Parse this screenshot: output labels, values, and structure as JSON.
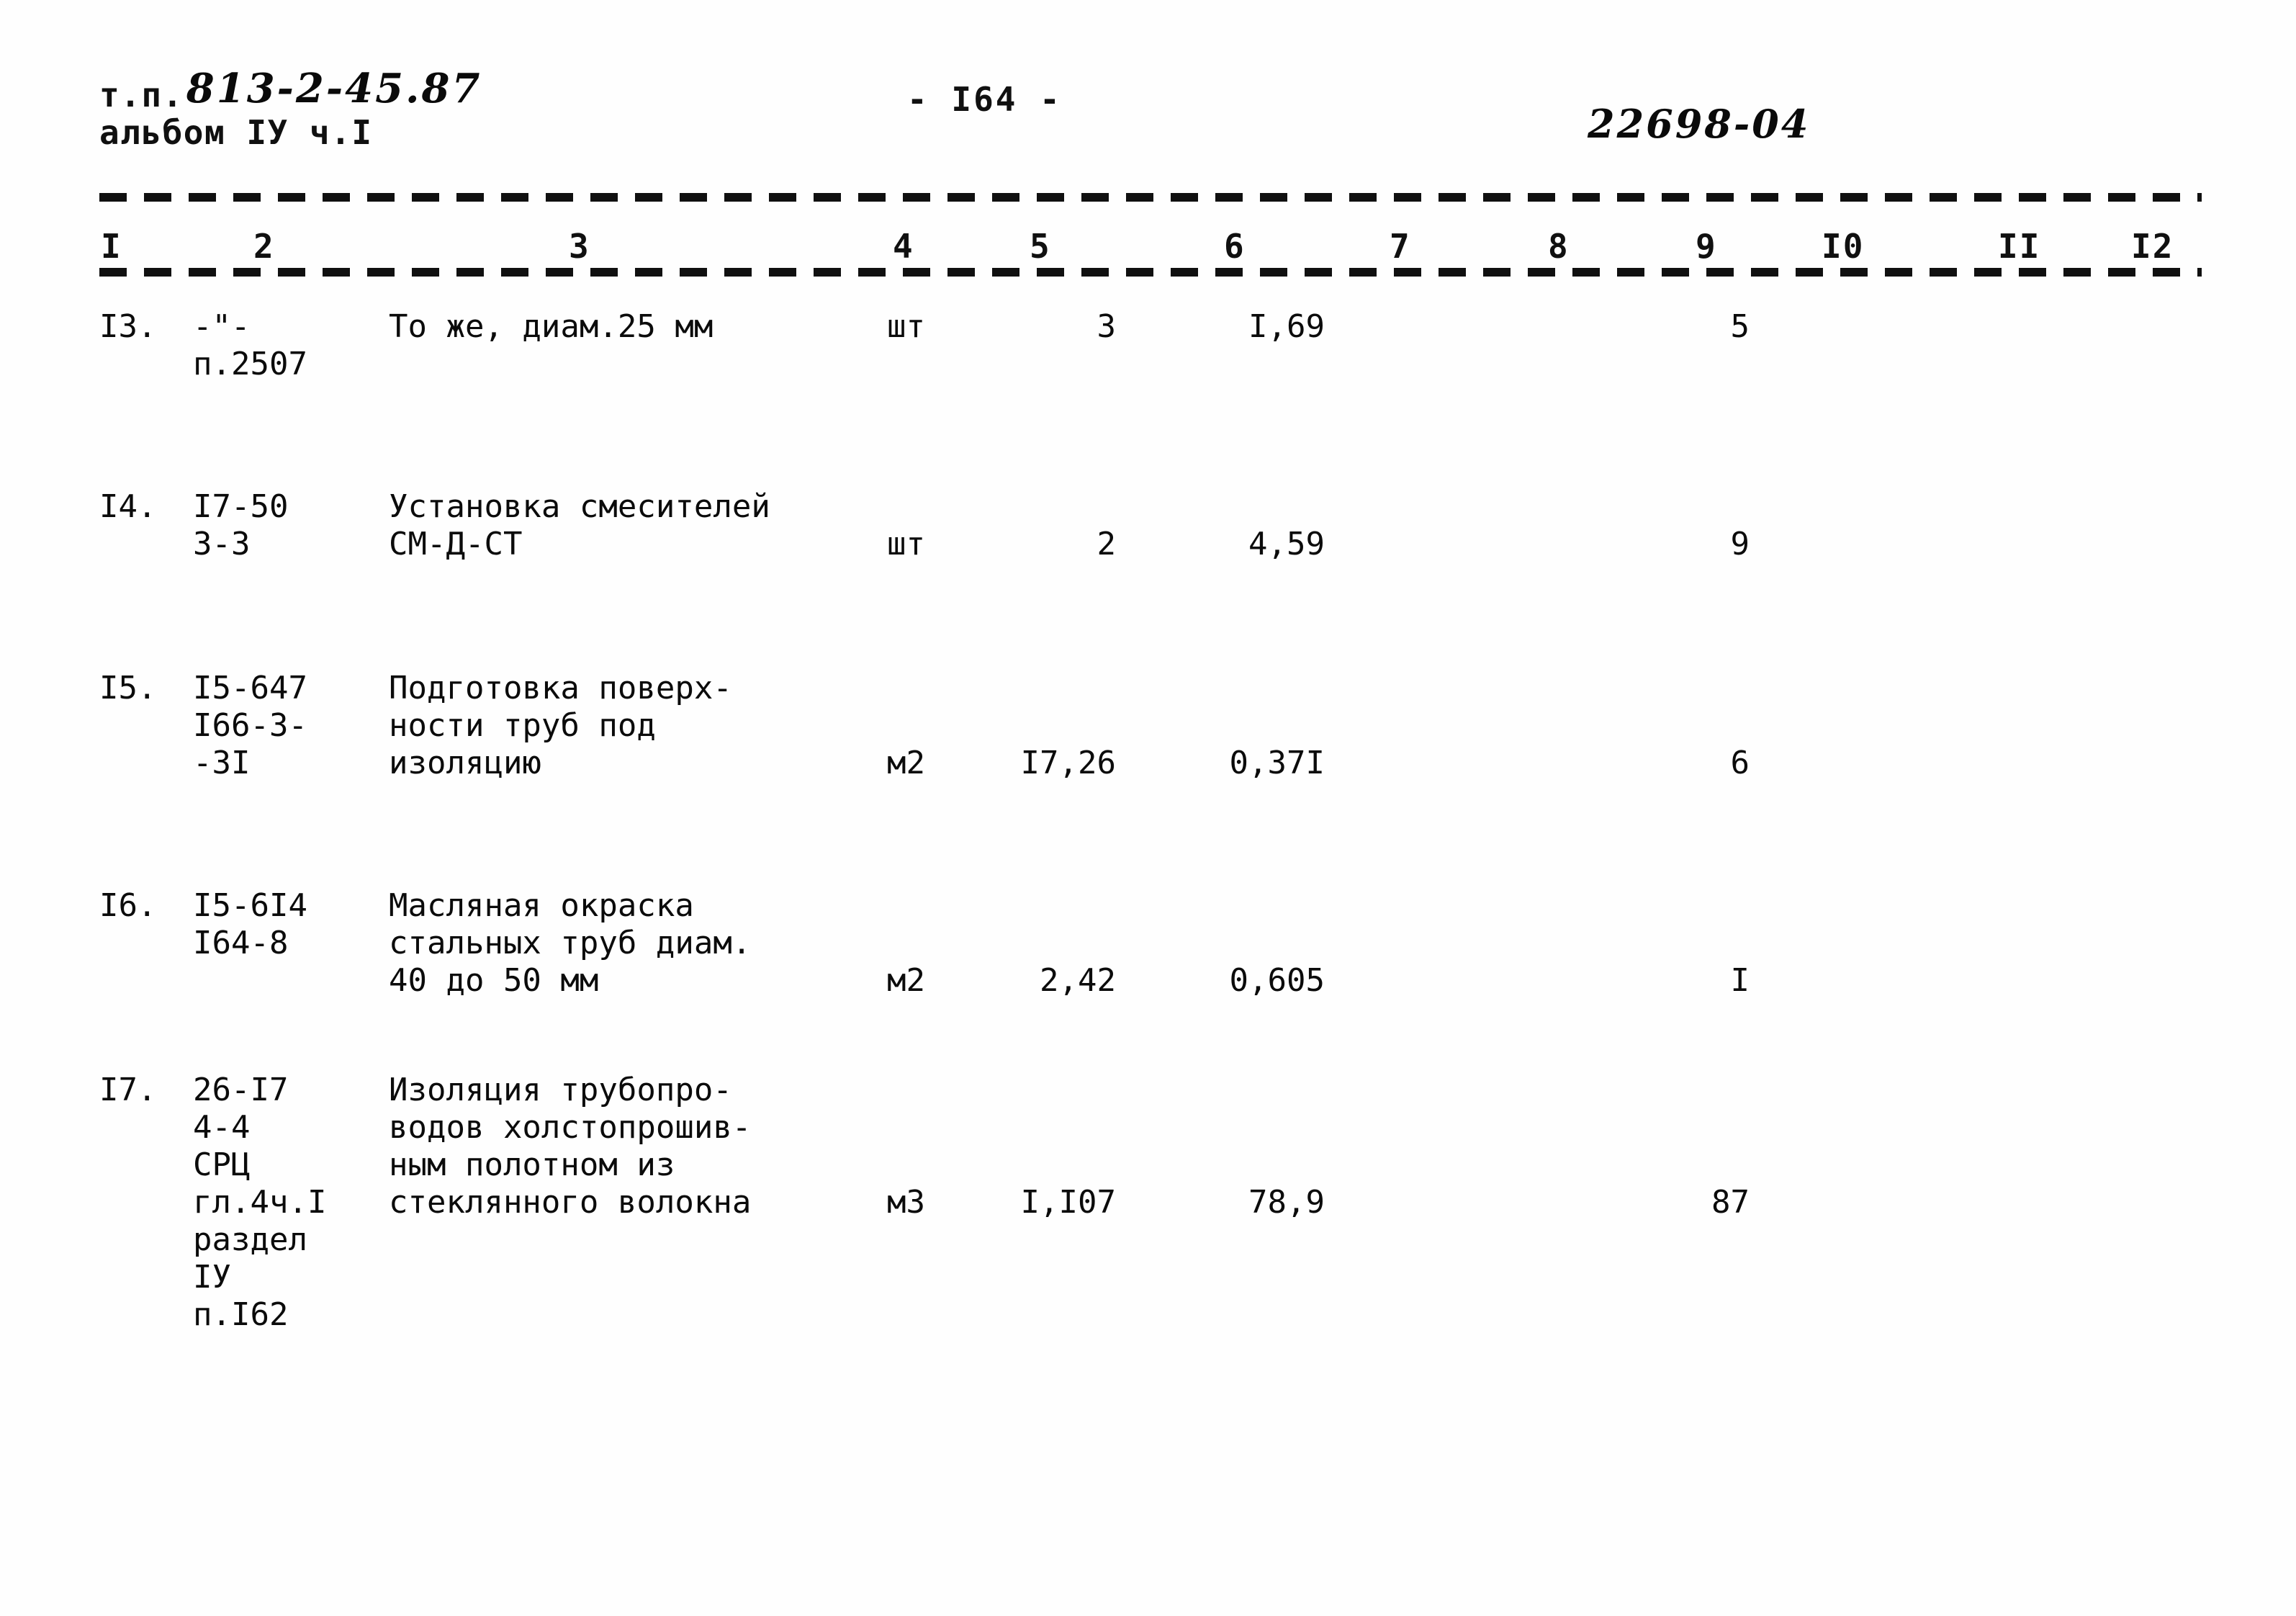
{
  "header": {
    "tp_label": "т.п.",
    "tp_code": "813-2-45.87",
    "album_line": "альбом IУ ч.I",
    "page_number": "- I64 -",
    "doc_number": "22698-04"
  },
  "table": {
    "column_numbers": [
      "I",
      "2",
      "3",
      "4",
      "5",
      "6",
      "7",
      "8",
      "9",
      "I0",
      "II",
      "I2"
    ],
    "rows": [
      {
        "num": "I3.",
        "code": "-\"-\nп.2507",
        "description": "То же, диам.25 мм",
        "unit": "шт",
        "qty": "3",
        "price": "I,69",
        "col7": "",
        "col8": "",
        "total": "5",
        "col10": "",
        "col11": "",
        "col12": ""
      },
      {
        "num": "I4.",
        "code": "I7-50\n3-3",
        "description": "Установка смесителей\nСМ-Д-СТ",
        "unit": "шт",
        "qty": "2",
        "price": "4,59",
        "col7": "",
        "col8": "",
        "total": "9",
        "col10": "",
        "col11": "",
        "col12": ""
      },
      {
        "num": "I5.",
        "code": "I5-647\nI66-3-\n-3I",
        "description": "Подготовка поверх-\nности труб под\nизоляцию",
        "unit": "м2",
        "qty": "I7,26",
        "price": "0,37I",
        "col7": "",
        "col8": "",
        "total": "6",
        "col10": "",
        "col11": "",
        "col12": ""
      },
      {
        "num": "I6.",
        "code": "I5-6I4\nI64-8",
        "description": "Масляная окраска\nстальных труб диам.\n40 до 50 мм",
        "unit": "м2",
        "qty": "2,42",
        "price": "0,605",
        "col7": "",
        "col8": "",
        "total": "I",
        "col10": "",
        "col11": "",
        "col12": ""
      },
      {
        "num": "I7.",
        "code": "26-I7\n4-4\nСРЦ\nгл.4ч.I\nраздел\nIУ\nп.I62",
        "description": "Изоляция трубопро-\nводов холстопрошив-\nным полотном из\nстеклянного волокна",
        "unit": "м3",
        "qty": "I,I07",
        "price": "78,9",
        "col7": "",
        "col8": "",
        "total": "87",
        "col10": "",
        "col11": "",
        "col12": ""
      }
    ]
  }
}
